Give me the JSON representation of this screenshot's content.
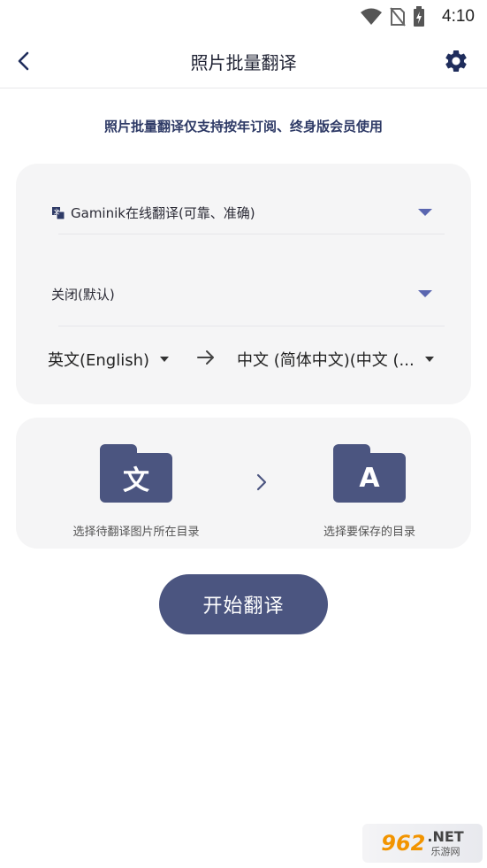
{
  "status_bar": {
    "time": "4:10"
  },
  "header": {
    "title": "照片批量翻译"
  },
  "notice": "照片批量翻译仅支持按年订阅、终身版会员使用",
  "engine_select": {
    "value": "Gaminik在线翻译(可靠、准确)"
  },
  "mode_select": {
    "value": "关闭(默认)"
  },
  "languages": {
    "source": "英文(English)",
    "target": "中文 (简体中文)(中文 (..."
  },
  "folders": {
    "source": {
      "glyph": "文",
      "caption": "选择待翻译图片所在目录"
    },
    "destination": {
      "glyph": "A",
      "caption": "选择要保存的目录"
    }
  },
  "start_button": {
    "label": "开始翻译"
  },
  "watermark": {
    "number": "962",
    "domain": ".NET",
    "sub": "乐游网"
  },
  "colors": {
    "accent": "#4b5580",
    "caret": "#5a66b0",
    "card_bg": "#f5f5f6"
  }
}
